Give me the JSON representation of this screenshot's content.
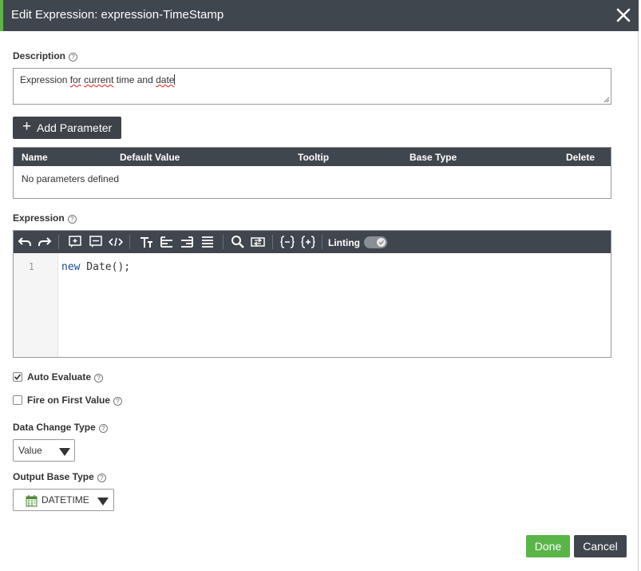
{
  "dialog": {
    "title": "Edit Expression: expression-TimeStamp",
    "accent_color": "#5cb83c",
    "header_color": "#40464e"
  },
  "description": {
    "label": "Description",
    "value_parts": [
      "Expression ",
      "for",
      " ",
      "current",
      " time and ",
      "date"
    ]
  },
  "parameters": {
    "add_button_label": "Add Parameter",
    "columns": [
      "Name",
      "Default Value",
      "Tooltip",
      "Base Type",
      "Delete"
    ],
    "empty_text": "No parameters defined"
  },
  "expression": {
    "label": "Expression",
    "toolbar_icons": [
      "undo-icon",
      "redo-icon",
      "insert-snippet-icon",
      "insert-comment-icon",
      "code-icon",
      "text-format-icon",
      "align-left-icon",
      "align-right-icon",
      "justify-icon",
      "search-icon",
      "replace-icon",
      "braces-icon",
      "braces-plus-icon"
    ],
    "linting_label": "Linting",
    "linting_enabled": true,
    "line_number": "1",
    "code_keyword": "new",
    "code_rest": " Date();"
  },
  "options": {
    "auto_evaluate_label": "Auto Evaluate",
    "auto_evaluate_checked": true,
    "fire_first_label": "Fire on First Value",
    "fire_first_checked": false
  },
  "data_change_type": {
    "label": "Data Change Type",
    "value": "Value"
  },
  "output_base_type": {
    "label": "Output Base Type",
    "value": "DATETIME",
    "icon": "calendar-icon"
  },
  "footer": {
    "done_label": "Done",
    "cancel_label": "Cancel",
    "done_color": "#5ab548"
  }
}
